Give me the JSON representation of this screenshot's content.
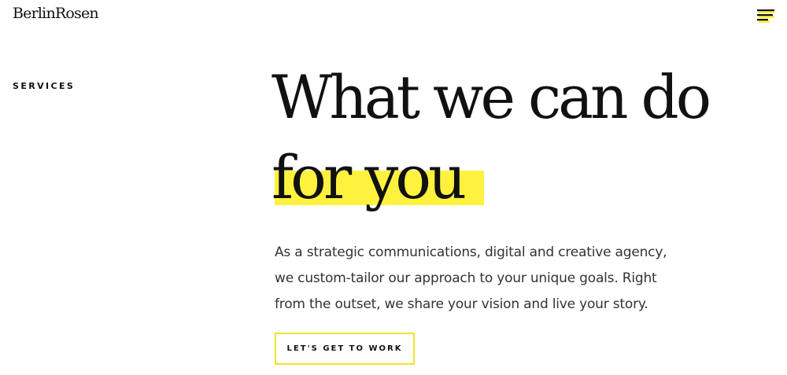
{
  "header": {
    "logo_text": "BerlinRosen",
    "menu_icon": "hamburger-menu-icon",
    "menu_accent_color": "#fff23f"
  },
  "section": {
    "label": "SERVICES"
  },
  "hero": {
    "headline_line1": "What we can do",
    "headline_line2": "for you",
    "highlight_color": "#fff23f",
    "intro": "As a strategic communications, digital and creative agency, we custom-tailor our approach to your unique goals. Right from the outset, we share your vision and live your story.",
    "cta_label": "LET'S GET TO WORK",
    "cta_border_color": "#f2e230"
  }
}
